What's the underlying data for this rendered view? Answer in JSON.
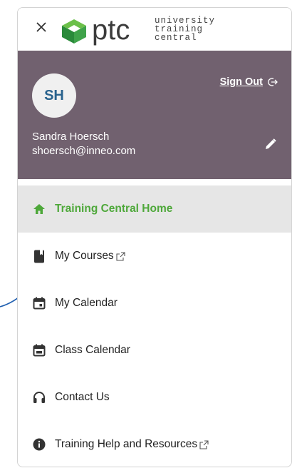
{
  "header": {
    "close_icon": "close-icon",
    "logo": {
      "brand": "ptc",
      "subtitle_lines": [
        "university",
        "training",
        "central"
      ],
      "brand_color": "#3b3b3b",
      "mark_colors": [
        "#2a8a3a",
        "#6cc04a"
      ]
    }
  },
  "user": {
    "initials": "SH",
    "name": "Sandra Hoersch",
    "email": "shoersch@inneo.com",
    "sign_out_label": "Sign Out",
    "panel_color": "#71616f",
    "avatar_text_color": "#29628d"
  },
  "nav": {
    "items": [
      {
        "label": "Training Central Home",
        "icon": "home-icon",
        "active": true,
        "external": false
      },
      {
        "label": "My Courses",
        "icon": "book-icon",
        "active": false,
        "external": true
      },
      {
        "label": "My Calendar",
        "icon": "calendar-icon",
        "active": false,
        "external": false
      },
      {
        "label": "Class Calendar",
        "icon": "calendar-icon",
        "active": false,
        "external": false
      },
      {
        "label": "Contact Us",
        "icon": "headset-icon",
        "active": false,
        "external": false
      },
      {
        "label": "Training Help and Resources",
        "icon": "info-icon",
        "active": false,
        "external": true
      }
    ],
    "active_color": "#4ea83a",
    "active_bg": "#e6e6e6"
  },
  "annotation": {
    "connector_color": "#1f5fb0"
  }
}
